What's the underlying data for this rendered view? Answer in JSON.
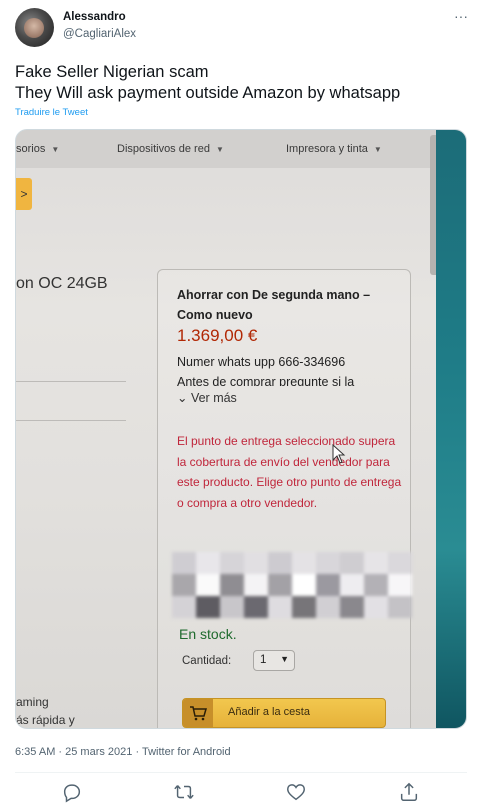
{
  "author": {
    "display_name": "Alessandro",
    "handle": "@CagliariAlex"
  },
  "tweet": {
    "text_lines": [
      "Fake Seller Nigerian scam",
      "They Will ask payment outside Amazon by whatsapp"
    ],
    "translate_label": "Traduire le Tweet",
    "timestamp": "6:35 AM · 25 mars 2021 · Twitter for Android",
    "more_glyph": "···"
  },
  "photo": {
    "nav": [
      "sorios",
      "Dispositivos de red",
      "Impresora y tinta"
    ],
    "yellow_button_glyph": ">",
    "product_title": "on OC 24GB",
    "left_text": [
      "aming",
      "ás rápida y"
    ],
    "offer_title": "Ahorrar con De segunda mano – Como nuevo",
    "price": "1.369,00 €",
    "note_line1": "Numer whats upp 666-334696",
    "note_line2": "Antes de comprar pregunte si la",
    "ver_mas": "Ver más",
    "warning": "El punto de entrega seleccionado supera la cobertura de envío del vendedor para este producto. Elige otro punto de entrega o compra a otro vendedor.",
    "stock": "En stock.",
    "qty_label": "Cantidad:",
    "qty_value": "1",
    "cart_label": "Añadir a la cesta"
  },
  "actions": [
    "reply-icon",
    "retweet-icon",
    "like-icon",
    "share-icon"
  ],
  "colors": {
    "link": "#1d9bf0",
    "secondary_text": "#536471",
    "price": "#b12704",
    "warning": "#c0263b",
    "stock": "#1f6b2e",
    "cart_button": "#f0c14b"
  }
}
